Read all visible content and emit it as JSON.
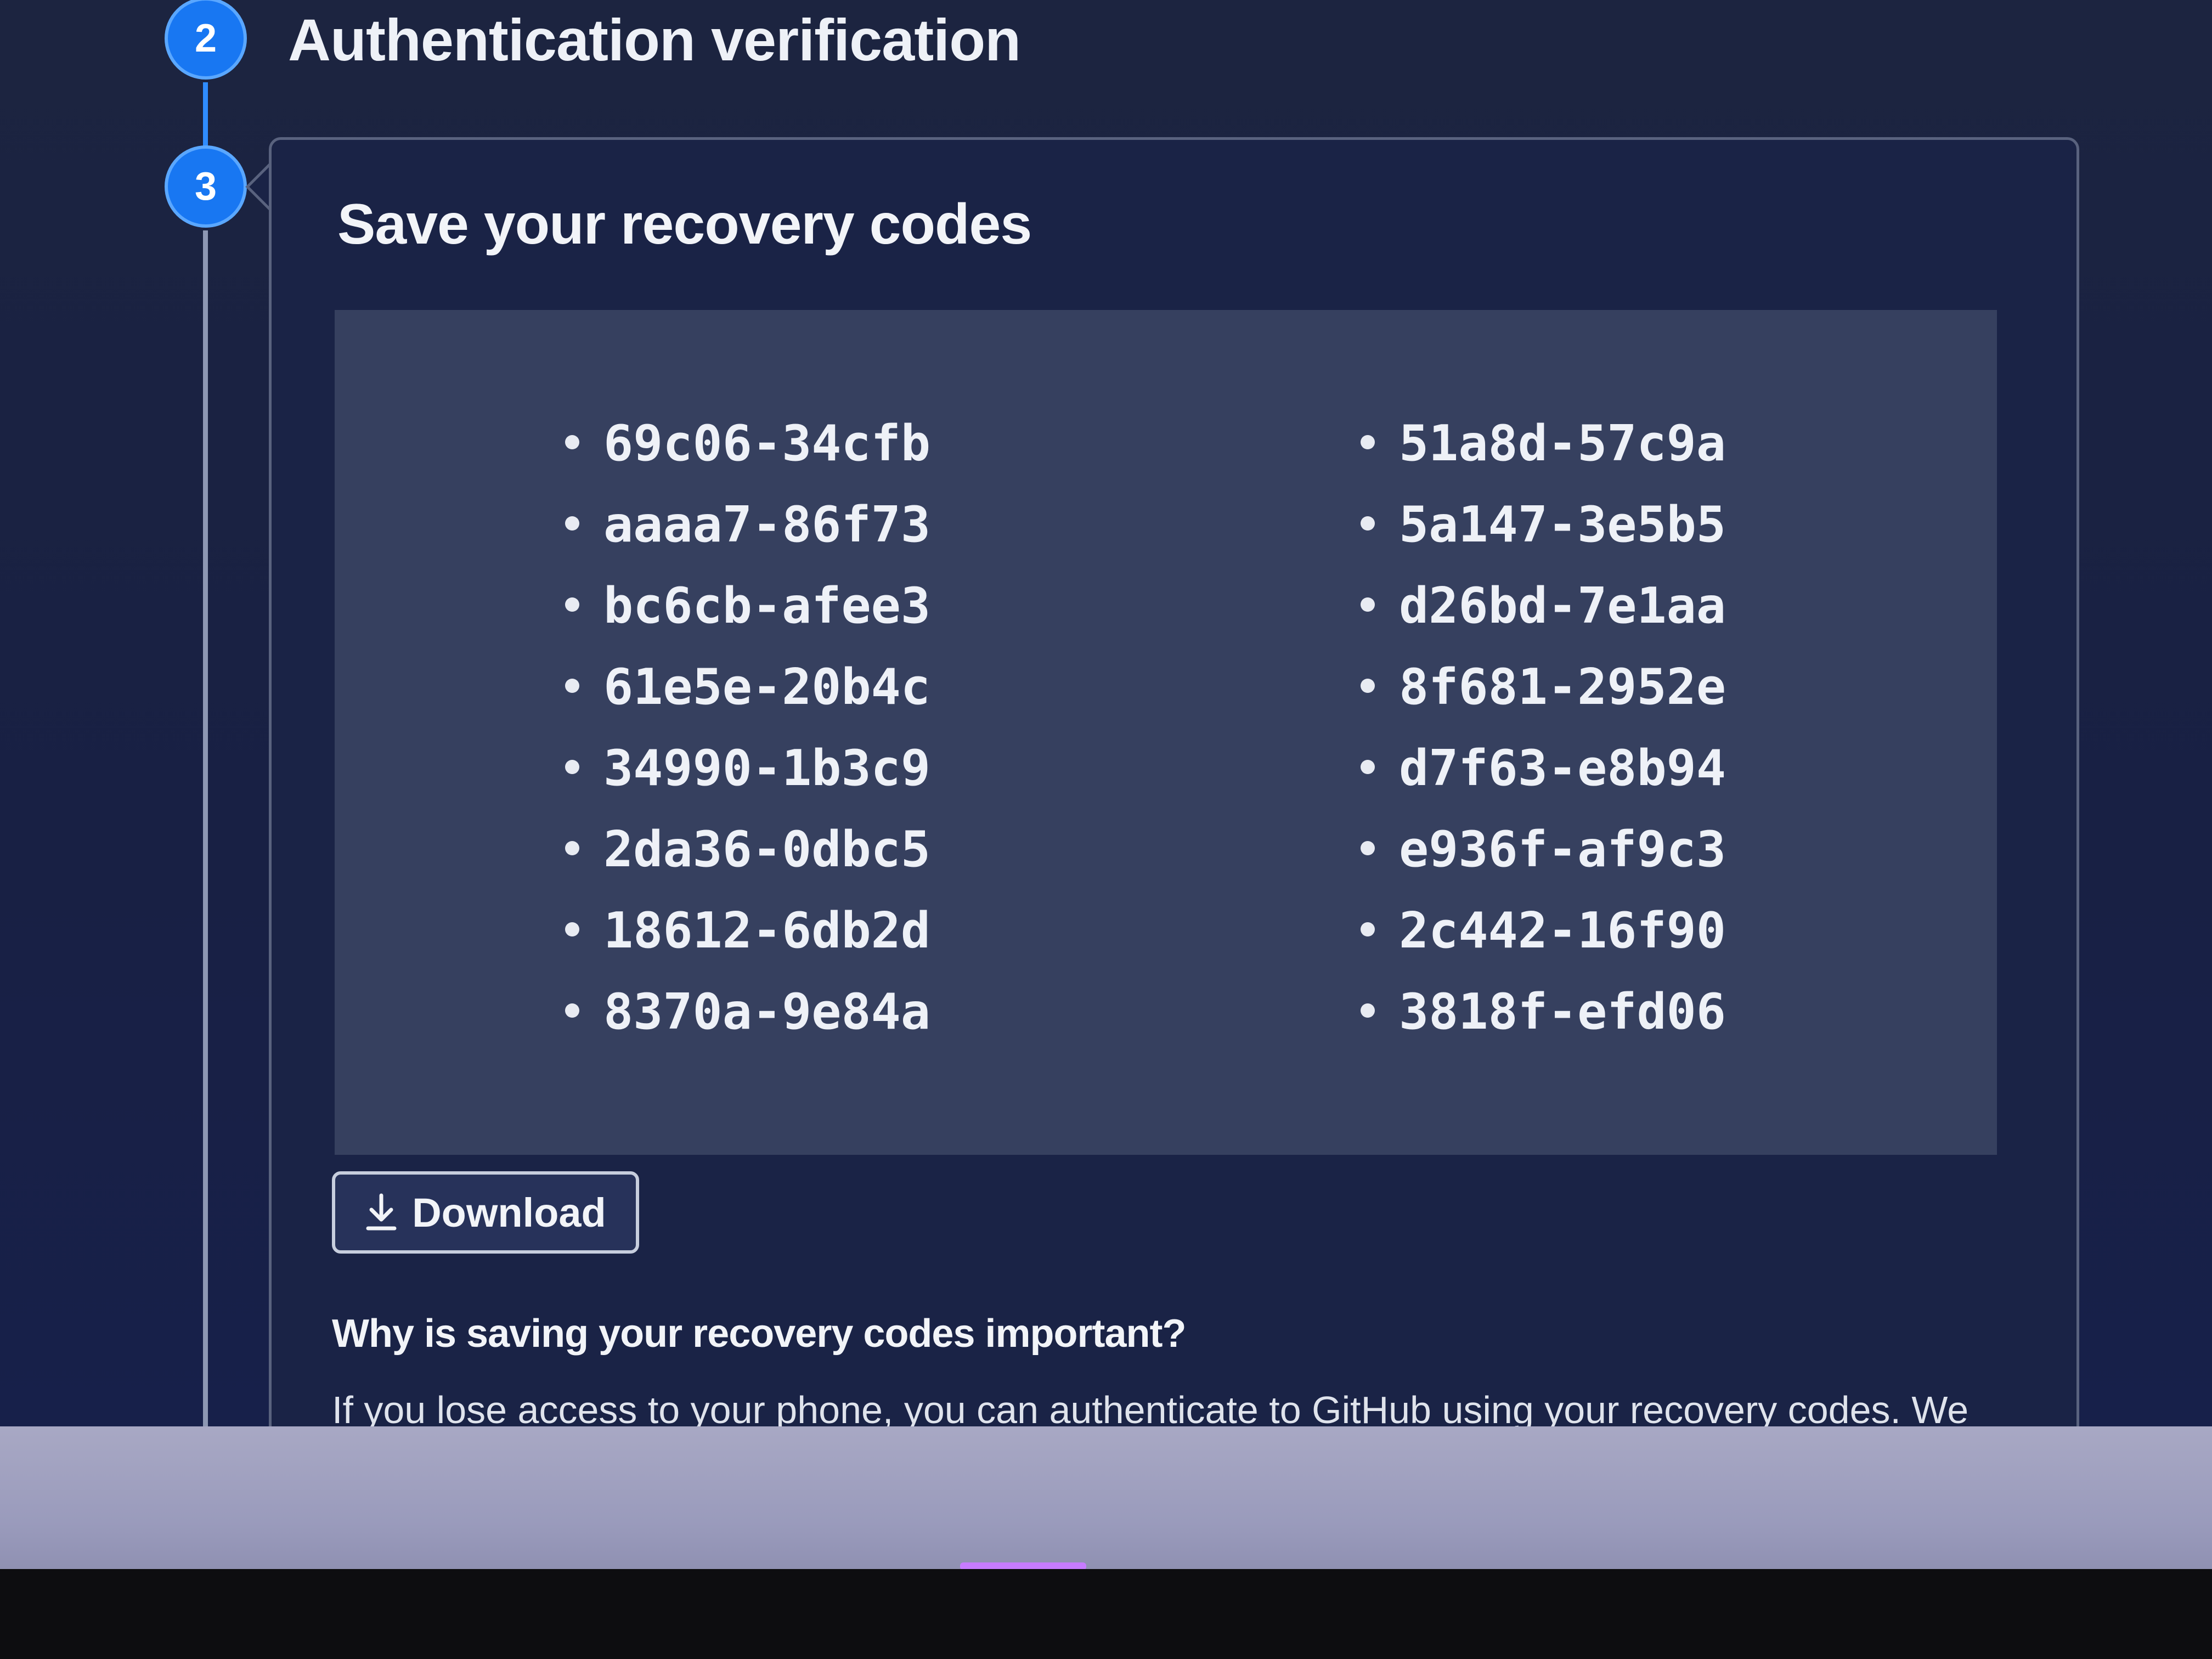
{
  "steps": [
    {
      "number": "2",
      "title": "Authentication verification"
    },
    {
      "number": "3",
      "title": "Save your recovery codes"
    }
  ],
  "recovery_codes": {
    "left": [
      "69c06-34cfb",
      "aaaa7-86f73",
      "bc6cb-afee3",
      "61e5e-20b4c",
      "34990-1b3c9",
      "2da36-0dbc5",
      "18612-6db2d",
      "8370a-9e84a"
    ],
    "right": [
      "51a8d-57c9a",
      "5a147-3e5b5",
      "d26bd-7e1aa",
      "8f681-2952e",
      "d7f63-e8b94",
      "e936f-af9c3",
      "2c442-16f90",
      "3818f-efd06"
    ]
  },
  "download": {
    "label": "Download",
    "icon": "download-icon"
  },
  "why": {
    "heading": "Why is saving your recovery codes important?",
    "text": "If you lose access to your phone, you can authenticate to GitHub using your recovery codes. We"
  },
  "colors": {
    "accent": "#1877f2",
    "background": "#1a2346",
    "codes_panel": "#36405f"
  }
}
